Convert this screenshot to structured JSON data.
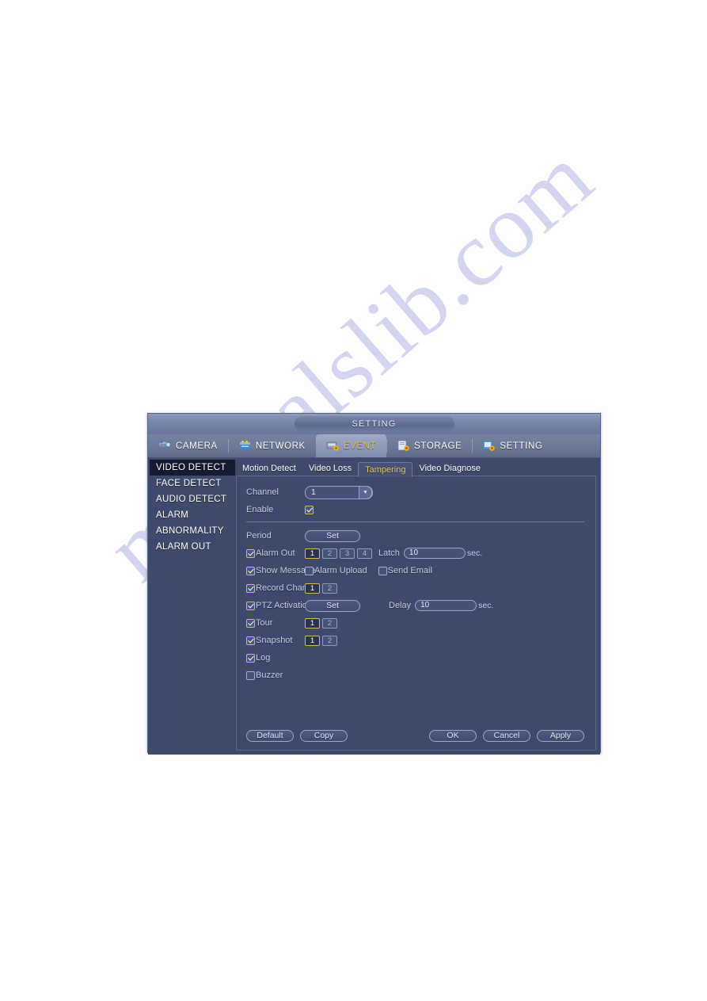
{
  "watermark": {
    "text": "manualslib.com"
  },
  "window": {
    "title": "SETTING"
  },
  "nav": {
    "items": [
      {
        "label": "CAMERA",
        "icon": "camera-icon",
        "active": false
      },
      {
        "label": "NETWORK",
        "icon": "network-icon",
        "active": false
      },
      {
        "label": "EVENT",
        "icon": "event-icon",
        "active": true
      },
      {
        "label": "STORAGE",
        "icon": "storage-icon",
        "active": false
      },
      {
        "label": "SETTING",
        "icon": "setting-icon",
        "active": false
      }
    ]
  },
  "sidebar": {
    "items": [
      {
        "label": "VIDEO DETECT",
        "active": true
      },
      {
        "label": "FACE DETECT",
        "active": false
      },
      {
        "label": "AUDIO DETECT",
        "active": false
      },
      {
        "label": "ALARM",
        "active": false
      },
      {
        "label": "ABNORMALITY",
        "active": false
      },
      {
        "label": "ALARM OUT",
        "active": false
      }
    ]
  },
  "subtabs": [
    {
      "label": "Motion Detect",
      "active": false
    },
    {
      "label": "Video Loss",
      "active": false
    },
    {
      "label": "Tampering",
      "active": true
    },
    {
      "label": "Video Diagnose",
      "active": false
    }
  ],
  "form": {
    "channel": {
      "label": "Channel",
      "value": "1"
    },
    "enable": {
      "label": "Enable",
      "checked": true
    },
    "period": {
      "label": "Period",
      "button": "Set"
    },
    "alarm_out": {
      "label": "Alarm Out",
      "checked": true,
      "chips": [
        {
          "label": "1",
          "on": true
        },
        {
          "label": "2",
          "on": false
        },
        {
          "label": "3",
          "on": false
        },
        {
          "label": "4",
          "on": false
        }
      ],
      "latch_label": "Latch",
      "latch_value": "10",
      "latch_unit": "sec."
    },
    "show_message": {
      "label": "Show Message",
      "checked": true
    },
    "alarm_upload": {
      "label": "Alarm Upload",
      "checked": false
    },
    "send_email": {
      "label": "Send Email",
      "checked": false
    },
    "record_channel": {
      "label": "Record Channel",
      "checked": true,
      "chips": [
        {
          "label": "1",
          "on": true
        },
        {
          "label": "2",
          "on": false
        }
      ]
    },
    "ptz_activation": {
      "label": "PTZ Activation",
      "checked": true,
      "button": "Set",
      "delay_label": "Delay",
      "delay_value": "10",
      "delay_unit": "sec."
    },
    "tour": {
      "label": "Tour",
      "checked": true,
      "chips": [
        {
          "label": "1",
          "on": true
        },
        {
          "label": "2",
          "on": false
        }
      ]
    },
    "snapshot": {
      "label": "Snapshot",
      "checked": true,
      "chips": [
        {
          "label": "1",
          "on": true
        },
        {
          "label": "2",
          "on": false
        }
      ]
    },
    "log": {
      "label": "Log",
      "checked": true
    },
    "buzzer": {
      "label": "Buzzer",
      "checked": false
    }
  },
  "buttons": {
    "default": "Default",
    "copy": "Copy",
    "ok": "OK",
    "cancel": "Cancel",
    "apply": "Apply"
  },
  "colors": {
    "dialog_bg": "#3e4a6b",
    "titlebar": "#7886a8",
    "accent_yellow": "#e8c84a",
    "checkbox_checked_border": "#e0b842",
    "sidebar_active_bg": "#141b33",
    "text": "#c3cbe4"
  }
}
